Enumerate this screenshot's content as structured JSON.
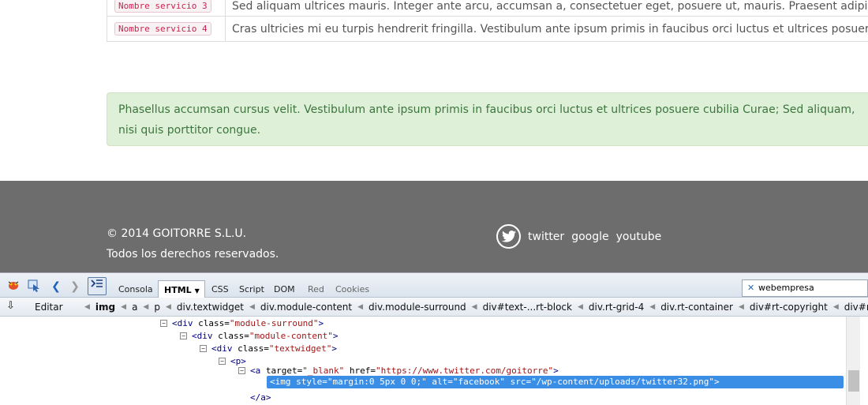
{
  "services": [
    {
      "name": "Nombre servicio 3",
      "desc": "Sed aliquam ultrices mauris. Integer ante arcu, accumsan a, consectetuer eget, posuere ut, mauris. Praesent adipiscing."
    },
    {
      "name": "Nombre servicio 4",
      "desc": "Cras ultricies mi eu turpis hendrerit fringilla. Vestibulum ante ipsum primis in faucibus orci luctus et ultrices posuere cubilia"
    }
  ],
  "alert": {
    "text": "Phasellus accumsan cursus velit. Vestibulum ante ipsum primis in faucibus orci luctus et ultrices posuere cubilia Curae; Sed aliquam, nisi quis porttitor congue."
  },
  "footer": {
    "copyright": "© 2014 GOITORRE S.L.U.",
    "rights": "Todos los derechos reservados.",
    "links": [
      "twitter",
      "google",
      "youtube"
    ]
  },
  "firebug": {
    "tabs": {
      "console": "Consola",
      "html": "HTML",
      "css": "CSS",
      "script": "Script",
      "dom": "DOM",
      "net": "Red",
      "cookies": "Cookies"
    },
    "search_value": "webempresa",
    "edit_label": "Editar",
    "breadcrumb": [
      "img",
      "a",
      "p",
      "div.textwidget",
      "div.module-content",
      "div.module-surround",
      "div#text-...rt-block",
      "div.rt-grid-4",
      "div.rt-container",
      "div#rt-copyright",
      "div#rt-foote"
    ],
    "tree": [
      {
        "tag": "<div",
        "attr": " class=",
        "val": "\"module-surround\"",
        "end": ">"
      },
      {
        "tag": "<div",
        "attr": " class=",
        "val": "\"module-content\"",
        "end": ">"
      },
      {
        "tag": "<div",
        "attr": " class=",
        "val": "\"textwidget\"",
        "end": ">"
      },
      {
        "tag": "<p>",
        "attr": "",
        "val": "",
        "end": ""
      },
      {
        "tag": "<a",
        "attr": " target=",
        "val": "\"_blank\"",
        "attr2": " href=",
        "val2": "\"https://www.twitter.com/goitorre\"",
        "end": ">"
      },
      {
        "tag": "<img",
        "attr": " style=",
        "val": "\"margin:0 5px 0 0;\"",
        "attr2": " alt=",
        "val2": "\"facebook\"",
        "attr3": " src=",
        "val3": "\"/wp-content/uploads/twitter32.png\"",
        "end": ">"
      },
      {
        "tag": "</a>",
        "attr": "",
        "val": "",
        "end": ""
      }
    ]
  },
  "colors": {
    "footer_bg": "#6d6d6d",
    "alert_bg": "#dff0d8",
    "alert_text": "#3c763d",
    "selection": "#3a8ee6"
  }
}
